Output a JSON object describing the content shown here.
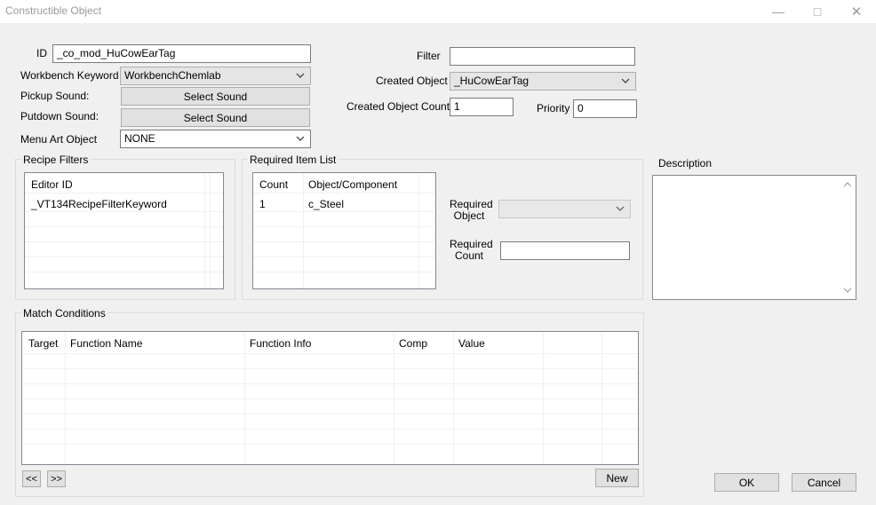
{
  "window": {
    "title": "Constructible Object",
    "minimize_glyph": "—",
    "maximize_glyph": "□",
    "close_glyph": "✕"
  },
  "fields": {
    "id_label": "ID",
    "id_value": "_co_mod_HuCowEarTag",
    "workbench_label": "Workbench Keyword",
    "workbench_value": "WorkbenchChemlab",
    "pickup_label": "Pickup Sound:",
    "putdown_label": "Putdown Sound:",
    "select_sound": "Select Sound",
    "menu_art_label": "Menu Art Object",
    "menu_art_value": "NONE",
    "filter_label": "Filter",
    "filter_value": "",
    "created_object_label": "Created Object",
    "created_object_value": "_HuCowEarTag",
    "created_count_label": "Created Object Count",
    "created_count_value": "1",
    "priority_label": "Priority",
    "priority_value": "0"
  },
  "recipe_filters": {
    "title": "Recipe Filters",
    "header": "Editor ID",
    "items": [
      "_VT134RecipeFilterKeyword"
    ]
  },
  "required_items": {
    "title": "Required Item List",
    "headers": [
      "Count",
      "Object/Component"
    ],
    "rows": [
      [
        "1",
        "c_Steel"
      ]
    ],
    "required_object_label_1": "Required",
    "required_object_label_2": "Object",
    "required_object_value": "",
    "required_count_label_1": "Required",
    "required_count_label_2": "Count",
    "required_count_value": ""
  },
  "description": {
    "label": "Description",
    "value": ""
  },
  "match_conditions": {
    "title": "Match Conditions",
    "headers": [
      "Target",
      "Function Name",
      "Function Info",
      "Comp",
      "Value"
    ],
    "prev_label": "<<",
    "next_label": ">>",
    "new_label": "New"
  },
  "dialog": {
    "ok_label": "OK",
    "cancel_label": "Cancel"
  }
}
